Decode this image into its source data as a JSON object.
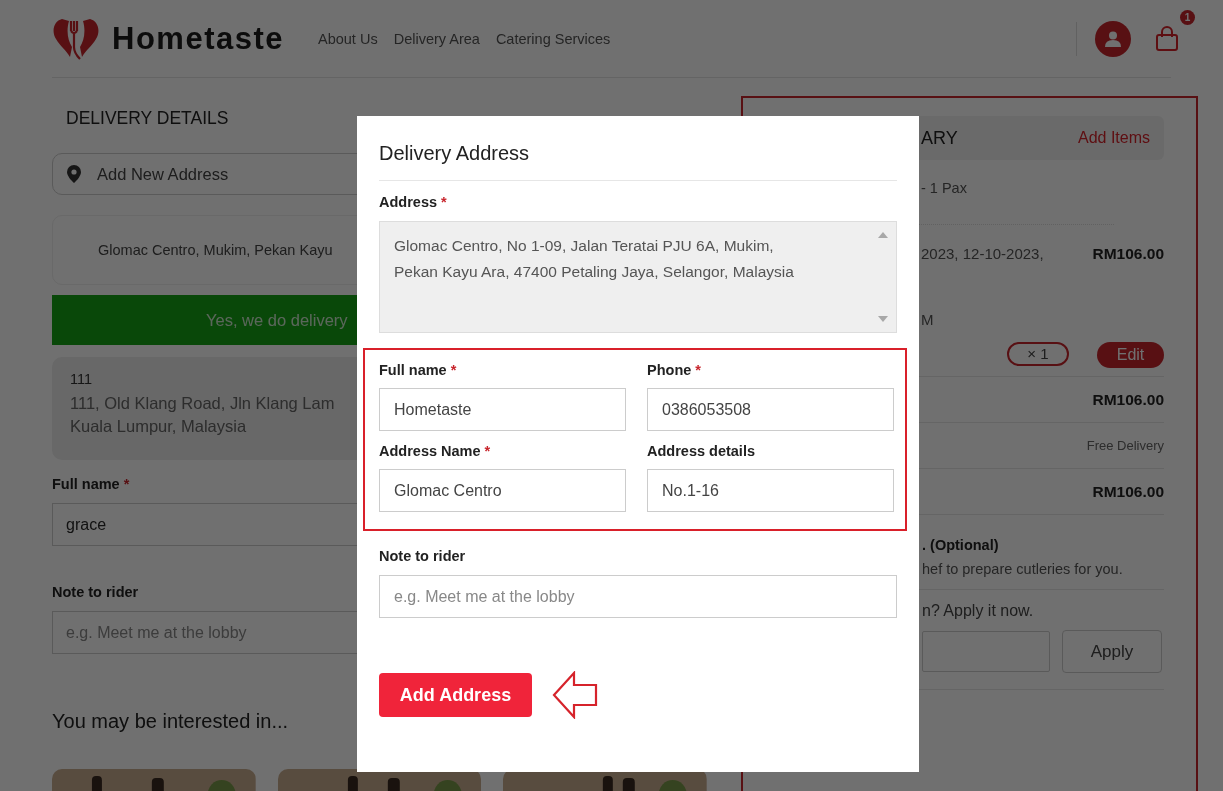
{
  "header": {
    "logo": "Hometaste",
    "nav": [
      {
        "label": "About Us"
      },
      {
        "label": "Delivery Area"
      },
      {
        "label": "Catering Services"
      }
    ],
    "cart_count": "1"
  },
  "delivery_details": {
    "title": "DELIVERY DETAILS",
    "add_address": "Add New Address",
    "saved_address": "Glomac Centro, Mukim, Pekan Kayu",
    "coverage_banner": "Yes, we do delivery",
    "selected_address": {
      "name": "111",
      "lines": [
        "111, Old Klang Road, Jln Klang Lam",
        "Kuala Lumpur, Malaysia"
      ]
    },
    "full_name": {
      "label": "Full name",
      "required_mark": "*",
      "value": "grace"
    },
    "note": {
      "label": "Note to rider",
      "placeholder": "e.g. Meet me at the lobby"
    }
  },
  "suggestions": {
    "title": "You may be interested in..."
  },
  "order_summary": {
    "title": "ARY",
    "add_items": "Add Items",
    "package": "- 1 Pax",
    "dates": "2023, 12-10-2023,",
    "price": "RM106.00",
    "time": "M",
    "quantity": "× 1",
    "edit": "Edit",
    "subtotal": "RM106.00",
    "delivery_fee": "Free Delivery",
    "total": "RM106.00",
    "cutlery_title": ". (Optional)",
    "cutlery_text": "hef to prepare cutleries for you.",
    "promo_prompt": "n? Apply it now.",
    "apply": "Apply"
  },
  "dialog": {
    "title": "Delivery Address",
    "address": {
      "label": "Address",
      "required_mark": "*",
      "value": "Glomac Centro, No 1-09, Jalan Teratai PJU 6A, Mukim, Pekan Kayu Ara, 47400 Petaling Jaya, Selangor, Malaysia"
    },
    "fields": [
      {
        "label": "Full name",
        "required_mark": "*",
        "value": "Hometaste"
      },
      {
        "label": "Phone",
        "required_mark": "*",
        "value": "0386053508"
      },
      {
        "label": "Address Name",
        "required_mark": "*",
        "value": "Glomac Centro"
      },
      {
        "label": "Address details",
        "value": "No.1-16"
      }
    ],
    "note": {
      "label": "Note to rider",
      "placeholder": "e.g. Meet me at the lobby"
    },
    "submit": "Add Address"
  }
}
